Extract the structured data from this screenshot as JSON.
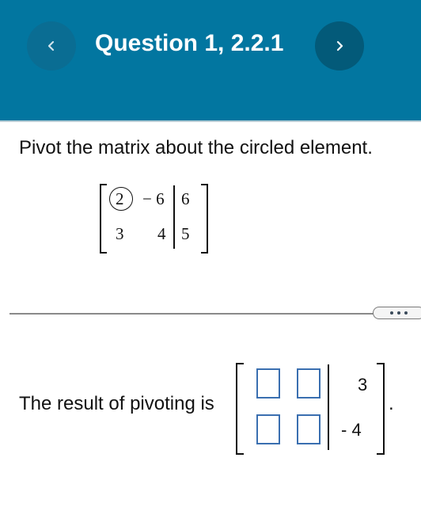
{
  "header": {
    "title": "Question 1, 2.2.1",
    "prev_icon": "chevron-left-icon",
    "next_icon": "chevron-right-icon"
  },
  "prompt": "Pivot the matrix about the circled element.",
  "given_matrix": {
    "rows": [
      [
        "2",
        "− 6",
        "6"
      ],
      [
        "3",
        "4",
        "5"
      ]
    ],
    "circled_element": "2"
  },
  "more_button_icon": "ellipsis-icon",
  "result": {
    "lead_text": "The result of pivoting is",
    "augmented_column": [
      "3",
      "- 4"
    ],
    "answer_inputs": [
      "",
      "",
      "",
      ""
    ],
    "trailing": "."
  }
}
